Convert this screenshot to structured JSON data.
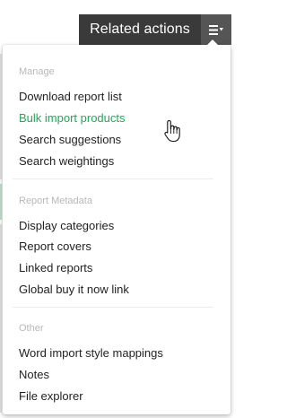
{
  "header": {
    "related_actions_label": "Related actions"
  },
  "menu": {
    "sections": [
      {
        "title": "Manage",
        "items": [
          "Download report list",
          "Bulk import products",
          "Search suggestions",
          "Search weightings"
        ]
      },
      {
        "title": "Report Metadata",
        "items": [
          "Display categories",
          "Report covers",
          "Linked reports",
          "Global buy it now link"
        ]
      },
      {
        "title": "Other",
        "items": [
          "Word import style mappings",
          "Notes",
          "File explorer"
        ]
      }
    ],
    "highlighted_item": "Bulk import products"
  },
  "colors": {
    "button_bg": "#3a3a3a",
    "toggle_bg": "#555555",
    "accent_green": "#27a55a",
    "section_title": "#b8b8b8"
  },
  "icons": {
    "toggle": "list-menu-icon",
    "cursor": "hand-pointer-icon"
  }
}
